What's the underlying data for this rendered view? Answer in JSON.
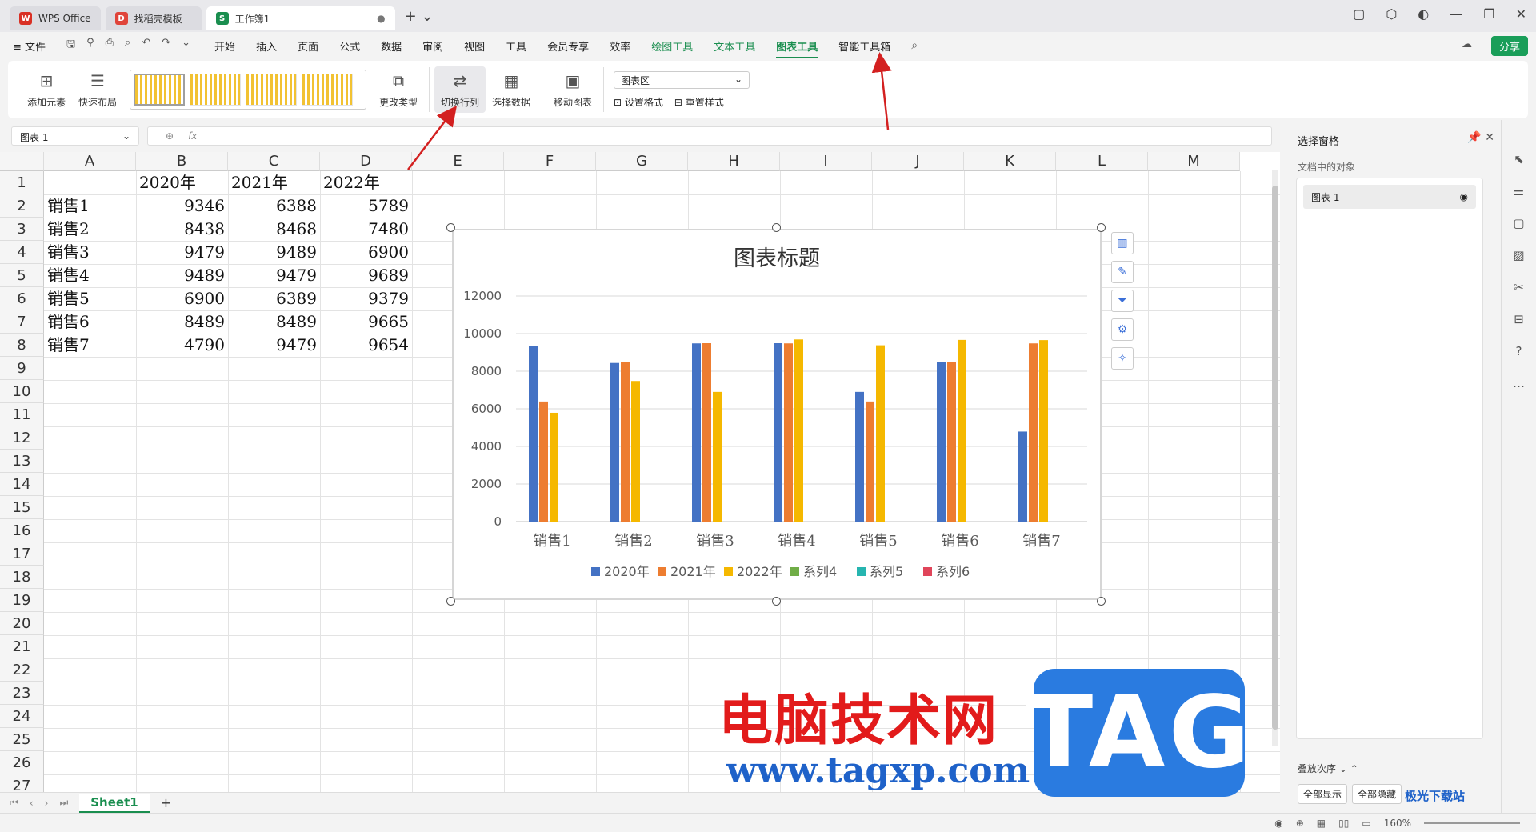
{
  "tabs": [
    {
      "label": "WPS Office",
      "logo": "W",
      "color": "#d93025"
    },
    {
      "label": "找稻壳模板",
      "logo": "D",
      "color": "#e0443a"
    },
    {
      "label": "工作簿1",
      "logo": "S",
      "color": "#1a8e4f"
    }
  ],
  "menu": {
    "file": "≡ 文件",
    "items": [
      "开始",
      "插入",
      "页面",
      "公式",
      "数据",
      "审阅",
      "视图",
      "工具",
      "会员专享",
      "效率"
    ],
    "green_items": [
      "绘图工具",
      "文本工具"
    ],
    "active": "图表工具",
    "last": "智能工具箱",
    "share": "分享"
  },
  "ribbon": {
    "add_element": "添加元素",
    "quick_layout": "快速布局",
    "change_type": "更改类型",
    "switch_row_col": "切换行列",
    "select_data": "选择数据",
    "move_chart": "移动图表",
    "chart_area": "图表区",
    "set_format": "设置格式",
    "reset_style": "重置样式"
  },
  "namebox": "图表 1",
  "formula_fx": "fx",
  "columns": [
    "A",
    "B",
    "C",
    "D",
    "E",
    "F",
    "G",
    "H",
    "I",
    "J",
    "K",
    "L",
    "M"
  ],
  "rows": [
    "1",
    "2",
    "3",
    "4",
    "5",
    "6",
    "7",
    "8",
    "9",
    "10",
    "11",
    "12",
    "13",
    "14",
    "15",
    "16",
    "17",
    "18",
    "19",
    "20",
    "21",
    "22",
    "23",
    "24",
    "25",
    "26",
    "27"
  ],
  "table": {
    "header": [
      "",
      "2020年",
      "2021年",
      "2022年"
    ],
    "rows": [
      [
        "销售1",
        "9346",
        "6388",
        "5789"
      ],
      [
        "销售2",
        "8438",
        "8468",
        "7480"
      ],
      [
        "销售3",
        "9479",
        "9489",
        "6900"
      ],
      [
        "销售4",
        "9489",
        "9479",
        "9689"
      ],
      [
        "销售5",
        "6900",
        "6389",
        "9379"
      ],
      [
        "销售6",
        "8489",
        "8489",
        "9665"
      ],
      [
        "销售7",
        "4790",
        "9479",
        "9654"
      ]
    ]
  },
  "chart_data": {
    "type": "bar",
    "title": "图表标题",
    "categories": [
      "销售1",
      "销售2",
      "销售3",
      "销售4",
      "销售5",
      "销售6",
      "销售7"
    ],
    "series": [
      {
        "name": "2020年",
        "color": "#4472c4",
        "values": [
          9346,
          8438,
          9479,
          9489,
          6900,
          8489,
          4790
        ]
      },
      {
        "name": "2021年",
        "color": "#ed7d31",
        "values": [
          6388,
          8468,
          9489,
          9479,
          6389,
          8489,
          9479
        ]
      },
      {
        "name": "2022年",
        "color": "#f5b800",
        "values": [
          5789,
          7480,
          6900,
          9689,
          9379,
          9665,
          9654
        ]
      },
      {
        "name": "系列4",
        "color": "#70ad47",
        "values": [
          0,
          0,
          0,
          0,
          0,
          0,
          0
        ]
      },
      {
        "name": "系列5",
        "color": "#26b5b0",
        "values": [
          0,
          0,
          0,
          0,
          0,
          0,
          0
        ]
      },
      {
        "name": "系列6",
        "color": "#e0455a",
        "values": [
          0,
          0,
          0,
          0,
          0,
          0,
          0
        ]
      }
    ],
    "yticks": [
      0,
      2000,
      4000,
      6000,
      8000,
      10000,
      12000
    ],
    "ylim": [
      0,
      12000
    ],
    "grid": true,
    "legend": "bottom"
  },
  "pane": {
    "title": "选择窗格",
    "subtitle": "文档中的对象",
    "item": "图表 1",
    "order": "叠放次序",
    "show_all": "全部显示",
    "hide_all": "全部隐藏"
  },
  "sheet_tab": "Sheet1",
  "zoom": "160%",
  "watermark": {
    "cn": "电脑技术网",
    "url": "www.tagxp.com",
    "tag": "TAG",
    "corner": "极光下载站"
  }
}
